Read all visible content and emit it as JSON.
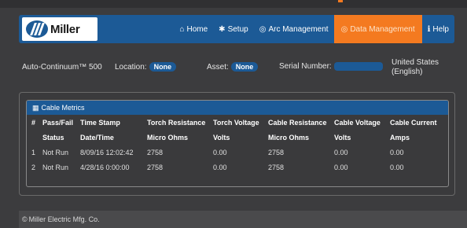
{
  "navbar": {
    "logo_text": "Miller",
    "items": [
      {
        "icon": "home-icon",
        "glyph": "⌂",
        "label": "Home"
      },
      {
        "icon": "gear-icon",
        "glyph": "✱",
        "label": "Setup"
      },
      {
        "icon": "arc-icon",
        "glyph": "◎",
        "label": "Arc Management"
      },
      {
        "icon": "data-icon",
        "glyph": "◎",
        "label": "Data Management",
        "active": true
      },
      {
        "icon": "help-icon",
        "glyph": "ℹ",
        "label": "Help"
      }
    ],
    "active_color": "#f47a20",
    "bar_color": "#1c5a96"
  },
  "info": {
    "model": "Auto-Continuum™ 500",
    "location_label": "Location:",
    "location_value": "None",
    "asset_label": "Asset:",
    "asset_value": "None",
    "serial_label": "Serial Number:",
    "serial_value": "",
    "language": "United States",
    "language_sub": "(English)"
  },
  "panel": {
    "title": "Cable Metrics",
    "icon": "table-icon",
    "headers": [
      [
        "#",
        ""
      ],
      [
        "Pass/Fail",
        "Status"
      ],
      [
        "Time Stamp",
        "Date/Time"
      ],
      [
        "Torch Resistance",
        "Micro Ohms"
      ],
      [
        "Torch Voltage",
        "Volts"
      ],
      [
        "Cable Resistance",
        "Micro Ohms"
      ],
      [
        "Cable Voltage",
        "Volts"
      ],
      [
        "Cable Current",
        "Amps"
      ]
    ],
    "rows": [
      [
        "1",
        "Not Run",
        "8/09/16 12:02:42",
        "2758",
        "0.00",
        "2758",
        "0.00",
        "0.00"
      ],
      [
        "2",
        "Not Run",
        "4/28/16 0:00:00",
        "2758",
        "0.00",
        "2758",
        "0.00",
        "0.00"
      ]
    ]
  },
  "footer": {
    "icon": "copyright-icon",
    "text": "Miller Electric Mfg. Co."
  }
}
